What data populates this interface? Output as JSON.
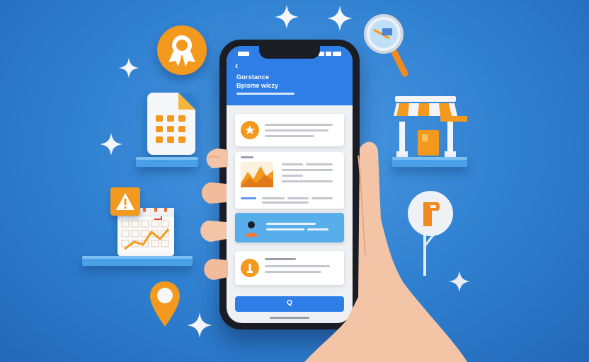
{
  "phone": {
    "back_glyph": "‹",
    "header_title": "Gorstance",
    "header_subtitle": "Bpisme wiczy",
    "cta_label": "Q"
  },
  "colors": {
    "background": "#2f7fd0",
    "accent_orange": "#f39a1e",
    "app_blue": "#2f7ee8",
    "card_blue": "#58aeea"
  },
  "icons": {
    "badge": "award-ribbon-icon",
    "document": "document-grid-icon",
    "calendar": "calendar-chart-icon",
    "warning": "warning-triangle-icon",
    "pin": "location-pin-icon",
    "magnifier": "magnifier-icon",
    "store": "storefront-icon",
    "sign": "signpost-icon"
  }
}
